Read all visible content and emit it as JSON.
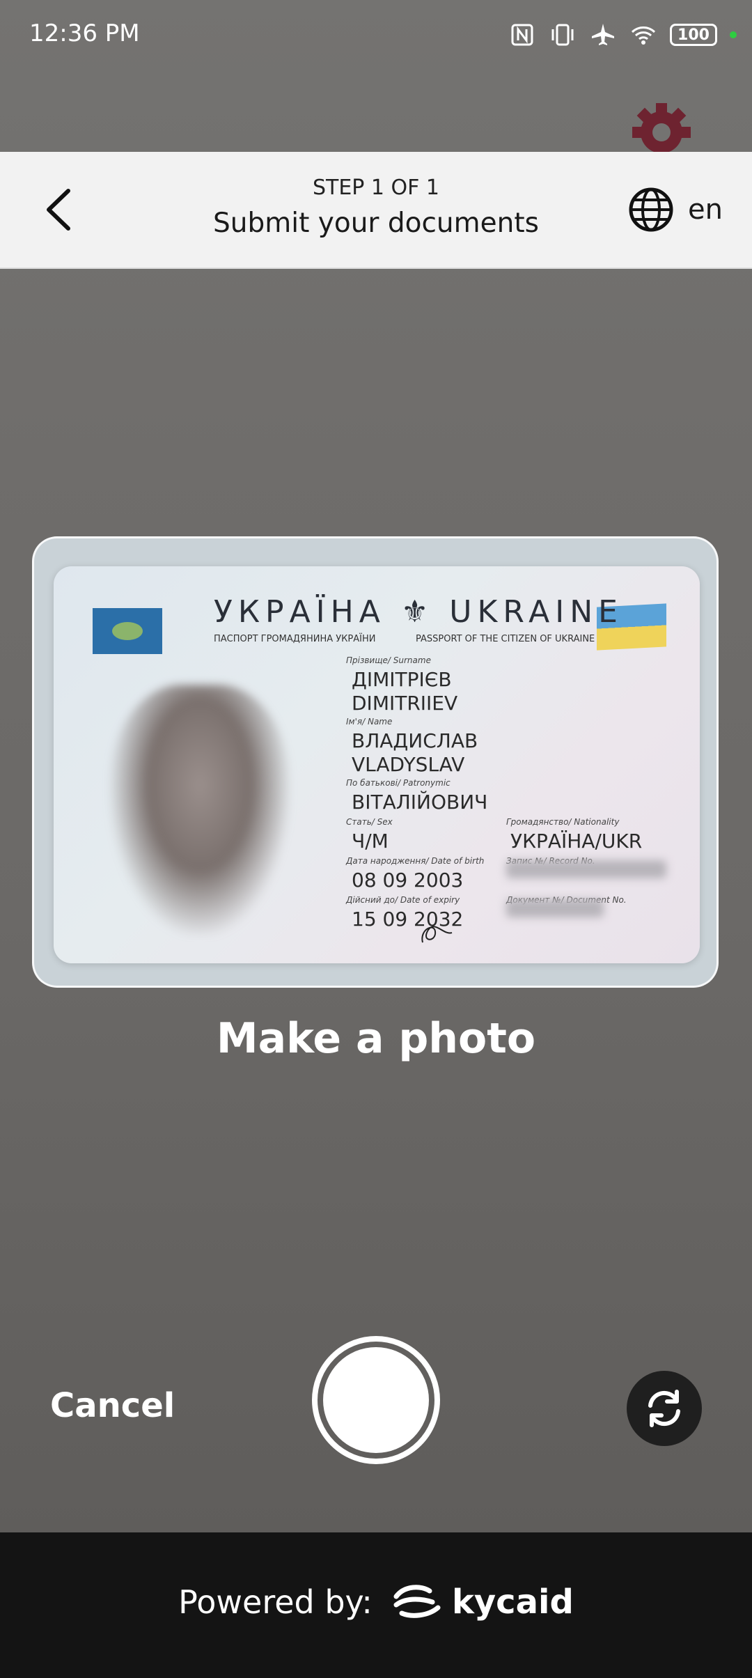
{
  "status_bar": {
    "time": "12:36 PM",
    "battery": "100",
    "icons": [
      "nfc-icon",
      "vibrate-icon",
      "airplane-icon",
      "wifi-icon"
    ]
  },
  "header": {
    "step": "STEP 1 OF 1",
    "title": "Submit your documents",
    "language": "en"
  },
  "document": {
    "country_title": "УКРАЇНА ⚜ UKRAINE",
    "subtitle_uk": "ПАСПОРТ ГРОМАДЯНИНА УКРАЇНИ",
    "subtitle_en": "PASSPORT OF THE CITIZEN OF UKRAINE",
    "surname_label": "Прізвище/ Surname",
    "surname_uk": "ДІМІТРІЄВ",
    "surname_en": "DIMITRIIEV",
    "name_label": "Ім'я/ Name",
    "name_uk": "ВЛАДИСЛАВ",
    "name_en": "VLADYSLAV",
    "patronymic_label": "По батькові/ Patronymic",
    "patronymic": "ВІТАЛІЙОВИЧ",
    "sex_label": "Стать/ Sex",
    "sex": "Ч/M",
    "dob_label": "Дата народження/ Date of birth",
    "dob": "08 09 2003",
    "expiry_label": "Дійсний до/ Date of expiry",
    "expiry": "15 09 2032",
    "nationality_label": "Громадянство/ Nationality",
    "nationality": "УКРАЇНА/UKR",
    "record_label": "Запис №/ Record No.",
    "document_label": "Документ №/ Document No."
  },
  "camera": {
    "instruction": "Make a photo",
    "cancel_label": "Cancel"
  },
  "footer": {
    "powered_by": "Powered by:",
    "brand": "kycaid"
  },
  "colors": {
    "header_bg": "#f2f2f2",
    "footer_bg": "#141414",
    "gear_accent": "#7a1f2e",
    "camera_bg": "#6d6b69"
  }
}
